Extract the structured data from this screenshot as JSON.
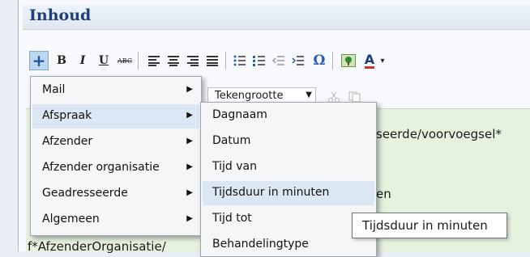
{
  "section": {
    "title": "Inhoud"
  },
  "toolbar": {
    "insert_icon_text": "+",
    "bold": "B",
    "italic": "I",
    "underline": "U",
    "strike": "ABC",
    "special_char": "Ω",
    "font_color": "A"
  },
  "font_size": {
    "label": "Tekengrootte"
  },
  "editor": {
    "line1": "seerde/voorvoegsel*",
    "line2": "en",
    "line3": "f*AfzenderOrganisatie/"
  },
  "menu_main": {
    "items": [
      {
        "label": "Mail"
      },
      {
        "label": "Afspraak"
      },
      {
        "label": "Afzender"
      },
      {
        "label": "Afzender organisatie"
      },
      {
        "label": "Geadresseerde"
      },
      {
        "label": "Algemeen"
      }
    ]
  },
  "menu_sub": {
    "items": [
      {
        "label": "Dagnaam"
      },
      {
        "label": "Datum"
      },
      {
        "label": "Tijd van"
      },
      {
        "label": "Tijdsduur in minuten"
      },
      {
        "label": "Tijd tot"
      },
      {
        "label": "Behandelingtype"
      }
    ]
  },
  "tooltip": {
    "text": "Tijdsduur in minuten"
  }
}
